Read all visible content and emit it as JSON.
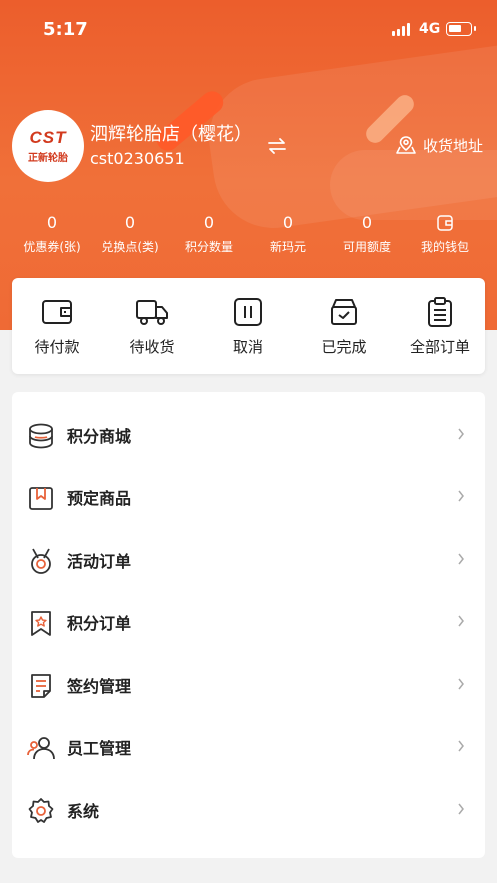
{
  "status_bar": {
    "time": "5:17",
    "network": "4G"
  },
  "profile": {
    "logo_text_top": "CST",
    "logo_text_bottom": "正新轮胎",
    "store_name": "泗辉轮胎店（樱花）",
    "store_id": "cst0230651",
    "address_label": "收货地址"
  },
  "stats": [
    {
      "value": "0",
      "label": "优惠券(张)"
    },
    {
      "value": "0",
      "label": "兑换点(类)"
    },
    {
      "value": "0",
      "label": "积分数量"
    },
    {
      "value": "0",
      "label": "新玛元"
    },
    {
      "value": "0",
      "label": "可用额度"
    },
    {
      "value": "",
      "label": "我的钱包",
      "icon": "wallet-icon"
    }
  ],
  "orders": [
    {
      "label": "待付款",
      "icon": "wallet-icon"
    },
    {
      "label": "待收货",
      "icon": "truck-icon"
    },
    {
      "label": "取消",
      "icon": "pause-icon"
    },
    {
      "label": "已完成",
      "icon": "box-check-icon"
    },
    {
      "label": "全部订单",
      "icon": "clipboard-icon"
    }
  ],
  "menu": [
    {
      "label": "积分商城",
      "icon": "coins-icon"
    },
    {
      "label": "预定商品",
      "icon": "gift-box-icon"
    },
    {
      "label": "活动订单",
      "icon": "medal-icon"
    },
    {
      "label": "积分订单",
      "icon": "bookmark-star-icon"
    },
    {
      "label": "签约管理",
      "icon": "document-icon"
    },
    {
      "label": "员工管理",
      "icon": "staff-icon"
    },
    {
      "label": "系统",
      "icon": "settings-icon"
    }
  ],
  "colors": {
    "brand": "#ef6433",
    "accent_icon": "#e8623a"
  }
}
